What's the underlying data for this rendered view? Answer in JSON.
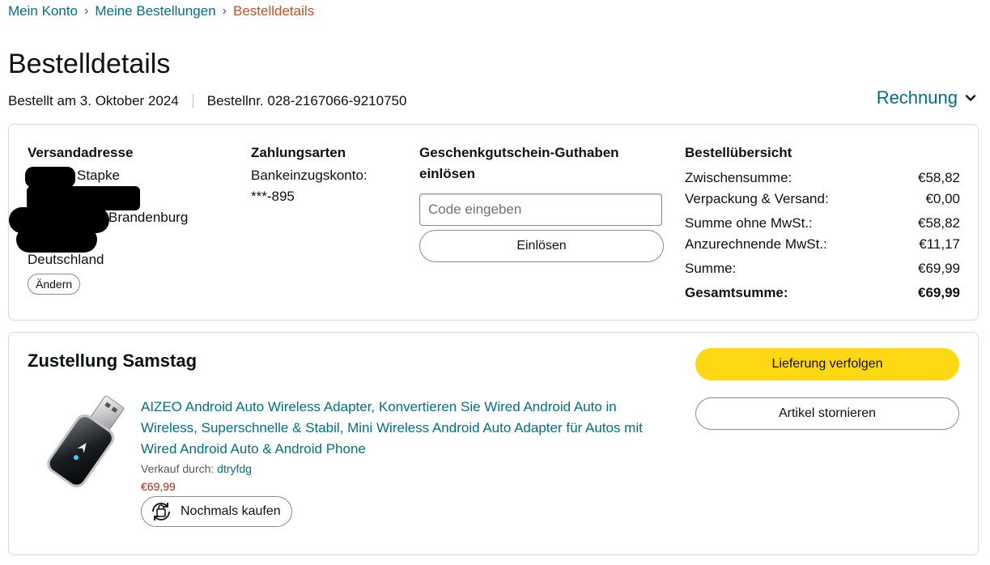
{
  "breadcrumb": {
    "items": [
      "Mein Konto",
      "Meine Bestellungen"
    ],
    "separator": "›",
    "current": "Bestelldetails"
  },
  "page": {
    "title": "Bestelldetails",
    "order_date": "Bestellt am 3. Oktober 2024",
    "order_number": "Bestellnr. 028-2167066-9210750",
    "invoice_label": "Rechnung"
  },
  "shipping": {
    "title": "Versandadresse",
    "line1": "Stapke",
    "line3": "Brandenburg",
    "country": "Deutschland",
    "change_label": "Ändern"
  },
  "payment": {
    "title": "Zahlungsarten",
    "method": "Bankeinzugskonto:",
    "account": "***-895"
  },
  "gift": {
    "title_line1": "Geschenkgutschein-Guthaben",
    "title_line2": "einlösen",
    "placeholder": "Code eingeben",
    "redeem_label": "Einlösen"
  },
  "summary": {
    "title": "Bestellübersicht",
    "rows": [
      {
        "label": "Zwischensumme:",
        "value": "€58,82"
      },
      {
        "label": "Verpackung & Versand:",
        "value": "€0,00"
      },
      {
        "label": "Summe ohne MwSt.:",
        "value": "€58,82"
      },
      {
        "label": "Anzurechnende MwSt.:",
        "value": "€11,17"
      },
      {
        "label": "Summe:",
        "value": "€69,99"
      }
    ],
    "total": {
      "label": "Gesamtsumme:",
      "value": "€69,99"
    }
  },
  "delivery": {
    "title": "Zustellung Samstag",
    "track_label": "Lieferung verfolgen",
    "cancel_label": "Artikel stornieren",
    "product": {
      "title": "AIZEO Android Auto Wireless Adapter, Konvertieren Sie Wired Android Auto in Wireless, Superschnelle & Stabil, Mini Wireless Android Auto Adapter für Autos mit Wired Android Auto & Android Phone",
      "seller_prefix": "Verkauf durch:",
      "seller": "dtryfdg",
      "price": "€69,99",
      "rebuy_label": "Nochmals kaufen"
    }
  },
  "colors": {
    "link": "#007185",
    "current": "#c7511f",
    "primary_button": "#ffd814",
    "price": "#b12704"
  }
}
